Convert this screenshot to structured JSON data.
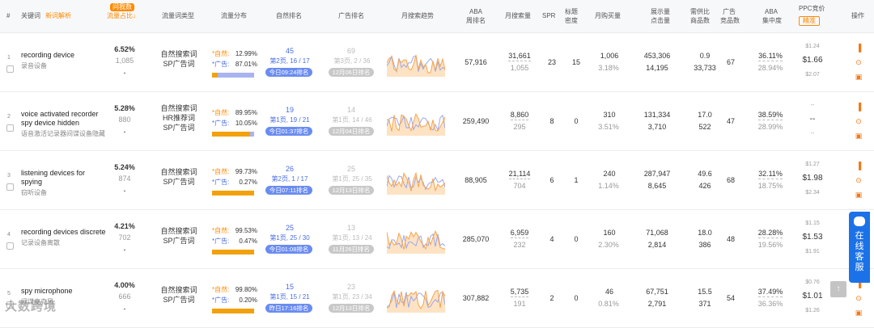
{
  "header": {
    "idx": "#",
    "keyword": "关键词",
    "analysis": "新词解析",
    "flow_tag": "问我数",
    "flow_share": "流量占比↓",
    "flow_type": "流量词类型",
    "dist": "流量分布",
    "nat_rank": "自然排名",
    "ad_rank": "广告排名",
    "trend": "月搜索趋势",
    "aba1": "ABA",
    "aba2": "周排名",
    "month_search": "月搜索量",
    "spr": "SPR",
    "title1": "标题",
    "title2": "密度",
    "month_buy": "月购买量",
    "impr1": "展示量",
    "impr2": "点击量",
    "supply1": "需供比",
    "supply2": "商品数",
    "adprod1": "广告",
    "adprod2": "竞品数",
    "aba_c1": "ABA",
    "aba_c2": "集中度",
    "ppc": "PPC竞价",
    "ppc_sel": "精准",
    "ops": "操作"
  },
  "rows": [
    {
      "n": "1",
      "kw": "recording device",
      "sub": "录音设备",
      "share": "6.52%",
      "share2": "1,085",
      "share3": "-",
      "types": [
        "自然搜索词",
        "SP广告词"
      ],
      "natlab": "*自然:",
      "natpct": "12.99%",
      "adlab": "*广告:",
      "adpct": "87.01%",
      "nat_frac": 0.13,
      "nr": "45",
      "nr2": "第2页, 16 / 17",
      "nrt": "今日09:24排名",
      "ar": "69",
      "ar2": "第3页, 2 / 36",
      "art": "12月06日排名",
      "aba": "57,916",
      "ms": "31,661",
      "ms2": "1,055",
      "spr": "23",
      "td": "15",
      "mb": "1,006",
      "mb2": "3.18%",
      "im": "453,306",
      "im2": "14,195",
      "sd": "0.9",
      "sd2": "33,733",
      "ap": "67",
      "ac": "36.11%",
      "ac2": "28.94%",
      "p1": "$1.24",
      "p2": "$1.66",
      "p3": "$2.07"
    },
    {
      "n": "2",
      "kw": "voice activated recorder spy device hidden",
      "sub": "语音激活记录器间谍设备隐藏",
      "share": "5.28%",
      "share2": "880",
      "share3": "-",
      "types": [
        "自然搜索词",
        "HR推荐词",
        "SP广告词"
      ],
      "natlab": "*自然:",
      "natpct": "89.95%",
      "adlab": "*广告:",
      "adpct": "10.05%",
      "nat_frac": 0.9,
      "nr": "19",
      "nr2": "第1页, 19 / 21",
      "nrt": "今日01:37排名",
      "ar": "14",
      "ar2": "第1页, 14 / 46",
      "art": "12月04日排名",
      "aba": "259,490",
      "ms": "8,860",
      "ms2": "295",
      "spr": "8",
      "td": "0",
      "mb": "310",
      "mb2": "3.51%",
      "im": "131,334",
      "im2": "3,710",
      "sd": "17.0",
      "sd2": "522",
      "ap": "47",
      "ac": "38.59%",
      "ac2": "28.99%",
      "p1": "--",
      "p2": "--",
      "p3": "--"
    },
    {
      "n": "3",
      "kw": "listening devices for spying",
      "sub": "窃听设备",
      "share": "5.24%",
      "share2": "874",
      "share3": "-",
      "types": [
        "自然搜索词",
        "SP广告词"
      ],
      "natlab": "*自然:",
      "natpct": "99.73%",
      "adlab": "*广告:",
      "adpct": "0.27%",
      "nat_frac": 0.997,
      "nr": "26",
      "nr2": "第2页, 1 / 17",
      "nrt": "今日07:11排名",
      "ar": "25",
      "ar2": "第1页, 25 / 35",
      "art": "12月13日排名",
      "aba": "88,905",
      "ms": "21,114",
      "ms2": "704",
      "spr": "6",
      "td": "1",
      "mb": "240",
      "mb2": "1.14%",
      "im": "287,947",
      "im2": "8,645",
      "sd": "49.6",
      "sd2": "426",
      "ap": "68",
      "ac": "32.11%",
      "ac2": "18.75%",
      "p1": "$1.27",
      "p2": "$1.98",
      "p3": "$2.34"
    },
    {
      "n": "4",
      "kw": "recording devices discrete",
      "sub": "记录设备离散",
      "share": "4.21%",
      "share2": "702",
      "share3": "-",
      "types": [
        "自然搜索词",
        "SP广告词"
      ],
      "natlab": "*自然:",
      "natpct": "99.53%",
      "adlab": "*广告:",
      "adpct": "0.47%",
      "nat_frac": 0.995,
      "nr": "25",
      "nr2": "第1页, 25 / 30",
      "nrt": "今日01:08排名",
      "ar": "13",
      "ar2": "第1页, 13 / 24",
      "art": "11月26日排名",
      "aba": "285,070",
      "ms": "6,959",
      "ms2": "232",
      "spr": "4",
      "td": "0",
      "mb": "160",
      "mb2": "2.30%",
      "im": "71,068",
      "im2": "2,814",
      "sd": "18.0",
      "sd2": "386",
      "ap": "48",
      "ac": "28.28%",
      "ac2": "19.56%",
      "p1": "$1.15",
      "p2": "$1.53",
      "p3": "$1.91"
    },
    {
      "n": "5",
      "kw": "spy microphone",
      "sub": "间谍麦克风",
      "share": "4.00%",
      "share2": "666",
      "share3": "-",
      "types": [
        "自然搜索词",
        "SP广告词"
      ],
      "natlab": "*自然:",
      "natpct": "99.80%",
      "adlab": "*广告:",
      "adpct": "0.20%",
      "nat_frac": 0.998,
      "nr": "15",
      "nr2": "第1页, 15 / 21",
      "nrt": "昨日17:16排名",
      "ar": "23",
      "ar2": "第1页, 23 / 34",
      "art": "12月13日排名",
      "aba": "307,882",
      "ms": "5,735",
      "ms2": "191",
      "spr": "2",
      "td": "0",
      "mb": "46",
      "mb2": "0.81%",
      "im": "67,751",
      "im2": "2,791",
      "sd": "15.5",
      "sd2": "371",
      "ap": "54",
      "ac": "37.49%",
      "ac2": "36.36%",
      "p1": "$0.76",
      "p2": "$1.01",
      "p3": "$1.26"
    }
  ],
  "side": {
    "label": "在线客服",
    "top": "↑"
  },
  "watermark": "大数跨境",
  "colors": {
    "accent": "#ff8a00",
    "blue": "#4a6ee0",
    "ad_bar": "#f2a10b",
    "nat_bar": "#a9b3ef",
    "side": "#1b72e8"
  }
}
